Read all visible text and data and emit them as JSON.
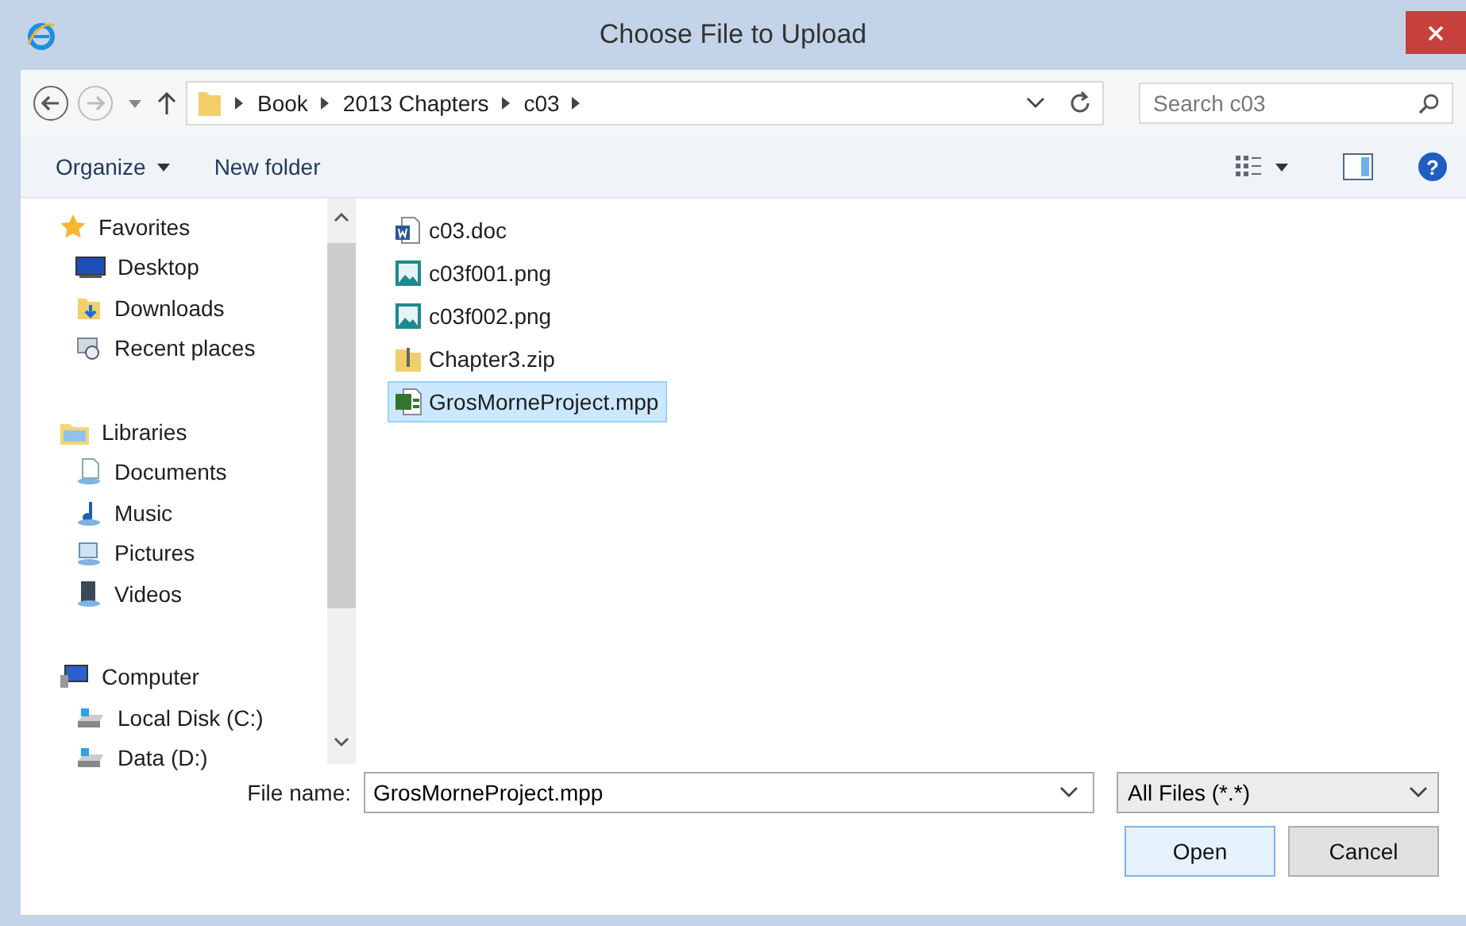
{
  "window": {
    "title": "Choose File to Upload"
  },
  "address_bar": {
    "breadcrumb": [
      "Book",
      "2013 Chapters",
      "c03"
    ],
    "search": {
      "placeholder": "Search c03"
    }
  },
  "toolbar": {
    "help": "?",
    "buttons": [
      {
        "label": "Organize",
        "has_menu": true
      },
      {
        "label": "New folder",
        "has_menu": false
      }
    ]
  },
  "navigation": [
    {
      "label": "Favorites",
      "kind": "favorites",
      "selected": false,
      "children": [
        {
          "label": "Desktop",
          "kind": "desktop",
          "selected": false
        },
        {
          "label": "Downloads",
          "kind": "downloads",
          "selected": false
        },
        {
          "label": "Recent places",
          "kind": "recent",
          "selected": false
        }
      ]
    },
    {
      "label": "Libraries",
      "kind": "libraries",
      "selected": false,
      "children": [
        {
          "label": "Documents",
          "kind": "documents",
          "selected": false
        },
        {
          "label": "Music",
          "kind": "music",
          "selected": false
        },
        {
          "label": "Pictures",
          "kind": "pictures",
          "selected": false
        },
        {
          "label": "Videos",
          "kind": "videos",
          "selected": false
        }
      ]
    },
    {
      "label": "Computer",
      "kind": "computer",
      "selected": false,
      "children": [
        {
          "label": "Local Disk (C:)",
          "kind": "drive",
          "selected": false
        },
        {
          "label": "Data (D:)",
          "kind": "drive",
          "selected": false
        }
      ]
    }
  ],
  "files": [
    {
      "name": "c03.doc",
      "kind": "word",
      "selected": false
    },
    {
      "name": "c03f001.png",
      "kind": "image",
      "selected": false
    },
    {
      "name": "c03f002.png",
      "kind": "image",
      "selected": false
    },
    {
      "name": "Chapter3.zip",
      "kind": "zip",
      "selected": false
    },
    {
      "name": "GrosMorneProject.mpp",
      "kind": "project",
      "selected": true
    }
  ],
  "footer": {
    "file_name_label": "File name:",
    "file_name": "GrosMorneProject.mpp",
    "filter": "All Files (*.*)",
    "buttons": [
      {
        "label": "Open",
        "default": true
      },
      {
        "label": "Cancel",
        "default": false
      }
    ]
  }
}
